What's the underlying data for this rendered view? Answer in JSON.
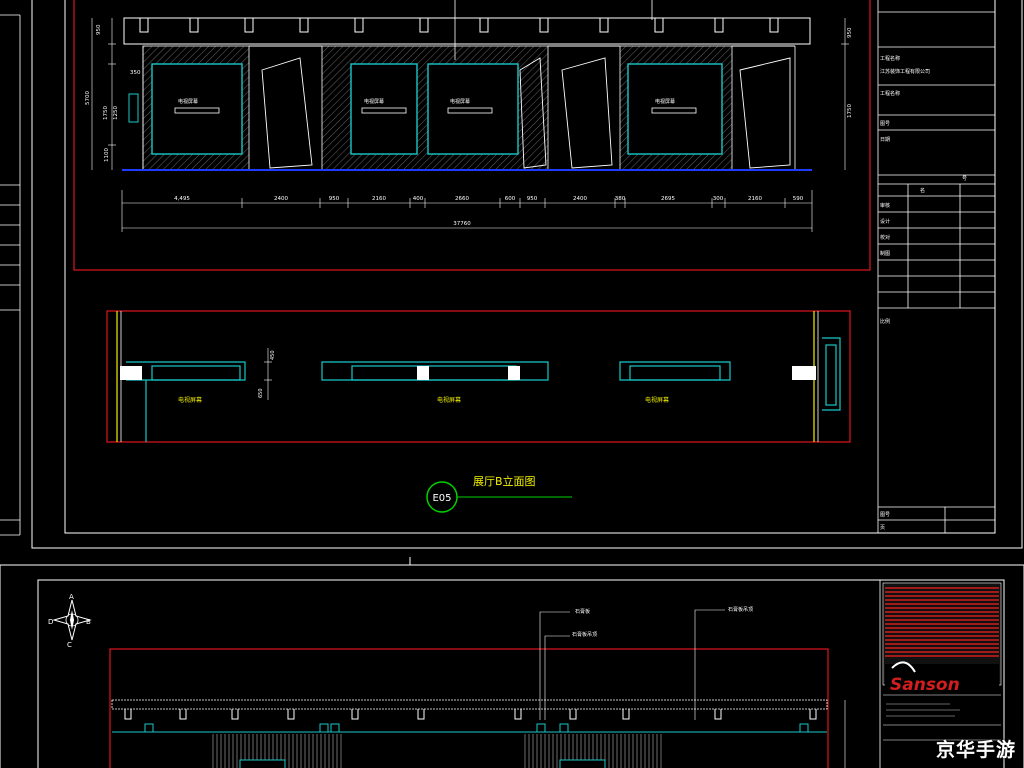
{
  "colors": {
    "frame": "#ffffff",
    "border": "#e0141e",
    "wall": "#18c8c8",
    "floor": "#1e3cff",
    "cad_text": "#ffffff",
    "label": "#f0f000",
    "tag": "#00d000",
    "logo_bg": "#d21e1e"
  },
  "upper_sheet": {
    "elevation": {
      "height_dims": [
        "950",
        "350",
        "1750",
        "1250",
        "1100",
        "5700"
      ],
      "width_dims": [
        "4,495",
        "2400",
        "950",
        "2160",
        "400",
        "2660",
        "600",
        "950",
        "2400",
        "380",
        "2695",
        "300",
        "2160",
        "590"
      ],
      "total_width": "37760",
      "panel_labels": [
        "电视屏幕",
        "电视屏幕",
        "电视屏幕",
        "电视屏幕"
      ],
      "right_dims": [
        "950",
        "1750"
      ]
    },
    "plan": {
      "dims": [
        "450",
        "650"
      ],
      "labels": [
        "电视屏幕",
        "电视屏幕",
        "电视屏幕"
      ]
    },
    "drawing_tag": {
      "code": "E05",
      "title": "展厅B立面图"
    },
    "title_block": {
      "company": "江苏装饰工程有限公司",
      "rows": [
        "工程名称",
        "工程名称",
        "图号",
        "日期",
        "审核",
        "设计",
        "校对",
        "制图",
        "比例"
      ],
      "cols": [
        "名",
        "号"
      ],
      "footer": [
        "图号",
        "页"
      ]
    }
  },
  "lower_sheet": {
    "compass": {
      "n": "A",
      "e": "B",
      "s": "C",
      "w": "D"
    },
    "labels": [
      "石膏板",
      "石膏板吊顶",
      "石膏板吊顶"
    ],
    "logo_text": "Sanson"
  },
  "watermark": "京华手游"
}
